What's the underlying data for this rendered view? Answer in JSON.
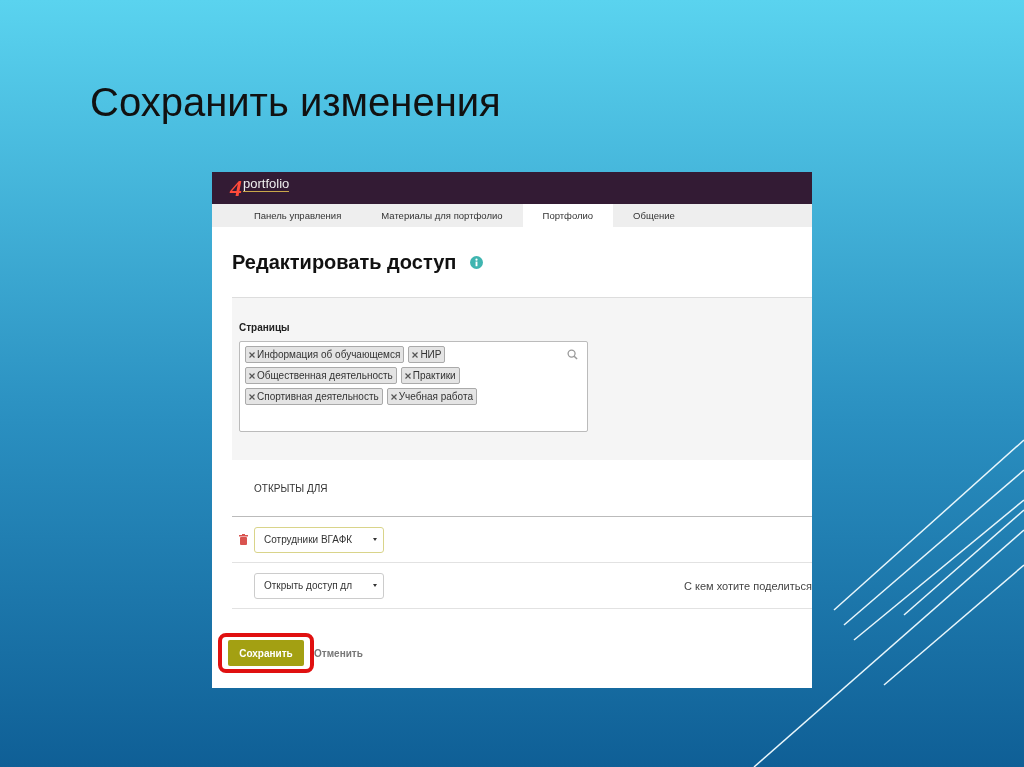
{
  "slide": {
    "title": "Сохранить изменения"
  },
  "app": {
    "logo": {
      "mark": "4",
      "text": "portfolio"
    },
    "tabs": [
      {
        "label": "Панель управления",
        "selected": false
      },
      {
        "label": "Материалы для портфолио",
        "selected": false
      },
      {
        "label": "Портфолио",
        "selected": true
      },
      {
        "label": "Общение",
        "selected": false
      }
    ],
    "heading": "Редактировать доступ",
    "pages": {
      "label": "Страницы",
      "tags": [
        "Информация об обучающемся",
        "НИР",
        "Общественная деятельность",
        "Практики",
        "Спортивная деятельность",
        "Учебная работа"
      ]
    },
    "access": {
      "heading": "ОТКРЫТЫ ДЛЯ",
      "rows": [
        {
          "value": "Сотрудники ВГАФК",
          "focused": true,
          "deletable": true
        },
        {
          "value": "Открыть доступ дл",
          "focused": false,
          "deletable": false,
          "hint": "С кем хотите поделиться"
        }
      ]
    },
    "save_button": {
      "label": "Сохранить",
      "highlighted": true
    },
    "cancel_link": "Отменить"
  }
}
